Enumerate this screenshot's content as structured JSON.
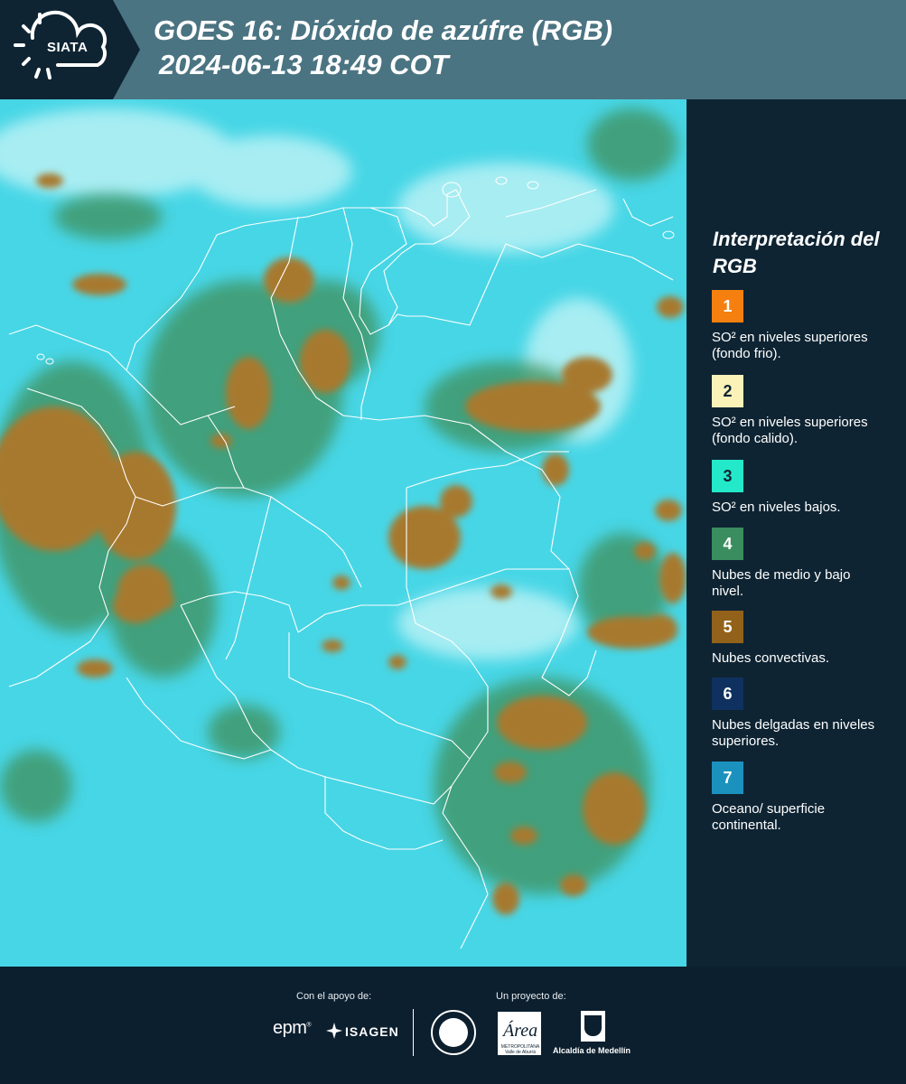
{
  "header": {
    "logo_text": "SIATA",
    "title_line1": "GOES 16: Dióxido de azúfre (RGB)",
    "title_line2": "2024-06-13 18:49 COT"
  },
  "map": {
    "ocean_land_color": "#47d6e6",
    "cloud_convective_color": "#a7792f",
    "cloud_mid_low_color": "#3f8f5a",
    "border_color": "#ffffff"
  },
  "legend": {
    "title": "Interpretación del RGB",
    "items": [
      {
        "number": "1",
        "color": "#f5800f",
        "text": "SO² en niveles superiores (fondo frio)."
      },
      {
        "number": "2",
        "color": "#fbf2b8",
        "text": "SO² en niveles superiores (fondo calido)."
      },
      {
        "number": "3",
        "color": "#23e8c9",
        "text": "SO² en niveles bajos."
      },
      {
        "number": "4",
        "color": "#3a8d5e",
        "text": "Nubes de medio y bajo nivel."
      },
      {
        "number": "5",
        "color": "#93621a",
        "text": "Nubes convectivas."
      },
      {
        "number": "6",
        "color": "#0f315f",
        "text": "Nubes delgadas en niveles superiores."
      },
      {
        "number": "7",
        "color": "#1b92bd",
        "text": "Oceano/ superficie continental."
      }
    ]
  },
  "footer": {
    "support_label": "Con el apoyo de:",
    "project_label": "Un proyecto de:",
    "epm_logo": "epm",
    "isagen_logo": "ISAGEN",
    "area_logo": "Área",
    "area_caption": "METROPOLITANA Valle de Aburrá",
    "alcaldia_logo": "Alcaldía de Medellín"
  }
}
